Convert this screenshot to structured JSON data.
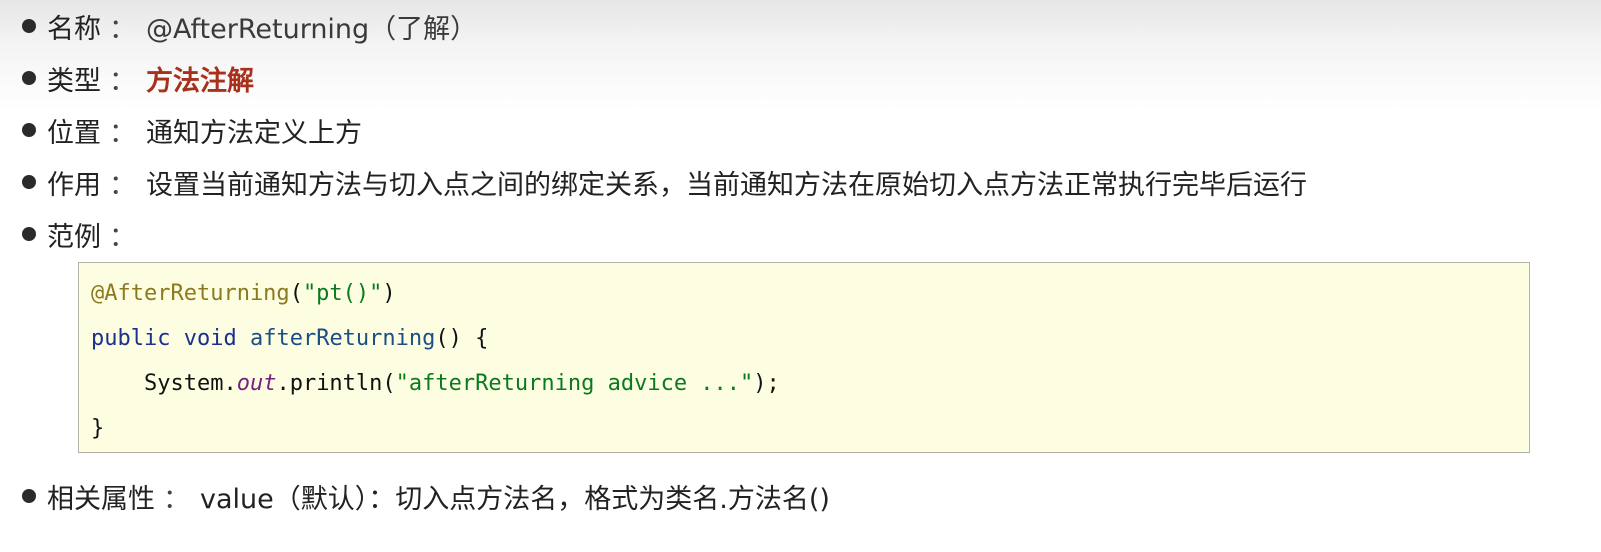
{
  "items": {
    "name": {
      "label": "名称",
      "sep": "：",
      "value": "@AfterReturning（了解）"
    },
    "type": {
      "label": "类型",
      "sep": "：",
      "value": "方法注解"
    },
    "position": {
      "label": "位置",
      "sep": "：",
      "value": "通知方法定义上方"
    },
    "purpose": {
      "label": "作用",
      "sep": "：",
      "value": "设置当前通知方法与切入点之间的绑定关系，当前通知方法在原始切入点方法正常执行完毕后运行"
    },
    "example": {
      "label": "范例",
      "sep": "："
    },
    "attributes": {
      "label": "相关属性",
      "sep": "：",
      "value": "value（默认）：切入点方法名，格式为类名.方法名()"
    }
  },
  "code": {
    "line1": {
      "annotation": "@AfterReturning",
      "open": "(",
      "string": "\"pt()\"",
      "close": ")"
    },
    "line2": {
      "kw_public": "public",
      "kw_void": "void",
      "method": "afterReturning",
      "rest": "() {"
    },
    "line3": {
      "indent": "    ",
      "system": "System.",
      "field": "out",
      "call": ".println(",
      "string": "\"afterReturning advice ...\"",
      "end": ");"
    },
    "line4": {
      "brace": "}"
    }
  },
  "colors": {
    "emphasis": "#a8311c",
    "code_background": "#fdfde2",
    "annotation": "#8c7a1e",
    "string": "#0b7a1e",
    "keyword": "#1b2f8f"
  }
}
